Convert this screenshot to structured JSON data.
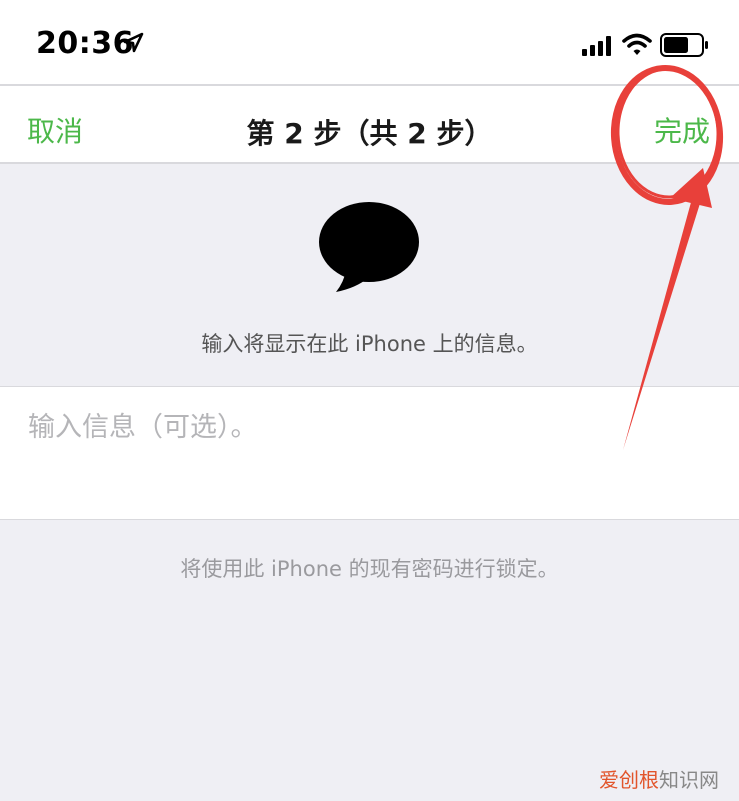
{
  "status_bar": {
    "time": "20:36",
    "location_icon": "location-arrow-icon",
    "signal_icon": "cellular-signal-icon",
    "wifi_icon": "wifi-icon",
    "battery_icon": "battery-icon"
  },
  "nav": {
    "cancel_label": "取消",
    "title": "第 2 步（共 2 步）",
    "done_label": "完成",
    "accent_color": "#4cb84a"
  },
  "content": {
    "icon": "speech-bubble-icon",
    "instruction": "输入将显示在此 iPhone 上的信息。",
    "input_placeholder": "输入信息（可选）。",
    "input_value": "",
    "footer_note": "将使用此 iPhone 的现有密码进行锁定。"
  },
  "annotation": {
    "color": "#e8403a"
  },
  "watermark": {
    "text_colored": "爱创根",
    "text_plain": "知识网"
  }
}
